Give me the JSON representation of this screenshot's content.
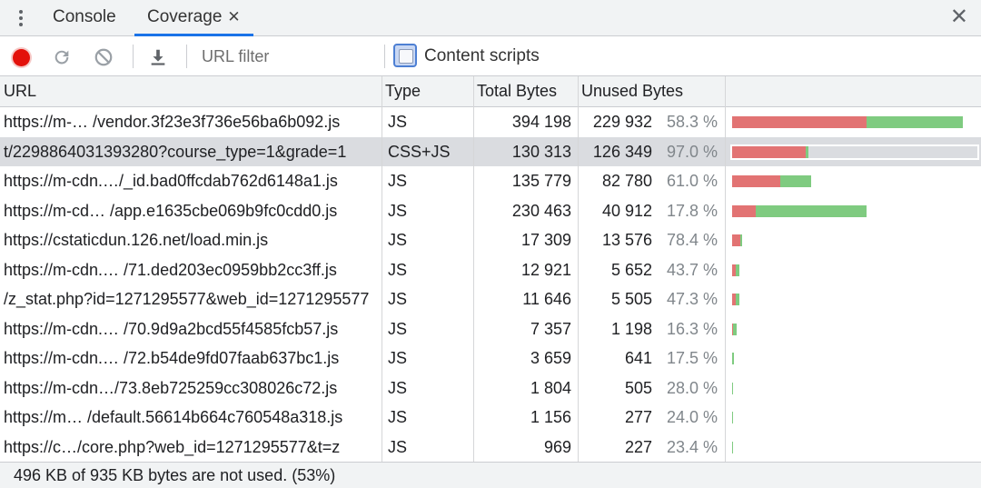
{
  "tabs": {
    "console": "Console",
    "coverage": "Coverage",
    "coverage_close": "✕"
  },
  "panel_close": "✕",
  "toolbar": {
    "url_filter_placeholder": "URL filter",
    "content_scripts_label": "Content scripts",
    "content_scripts_checked": false
  },
  "columns": {
    "url": "URL",
    "type": "Type",
    "total": "Total Bytes",
    "unused": "Unused Bytes"
  },
  "colors": {
    "unused": "#e27373",
    "used": "#7fcb80",
    "record": "#e3110b",
    "tab_accent": "#1a73e8"
  },
  "rows": [
    {
      "url": "https://m-… /vendor.3f23e3f736e56ba6b092.js",
      "type": "JS",
      "total": "394 198",
      "unused": "229 932",
      "pct": "58.3 %",
      "total_n": 394198,
      "unused_n": 229932
    },
    {
      "url": "t/2298864031393280?course_type=1&grade=1",
      "type": "CSS+JS",
      "total": "130 313",
      "unused": "126 349",
      "pct": "97.0 %",
      "total_n": 130313,
      "unused_n": 126349,
      "selected": true
    },
    {
      "url": "https://m-cdn.…/_id.bad0ffcdab762d6148a1.js",
      "type": "JS",
      "total": "135 779",
      "unused": "82 780",
      "pct": "61.0 %",
      "total_n": 135779,
      "unused_n": 82780
    },
    {
      "url": "https://m-cd… /app.e1635cbe069b9fc0cdd0.js",
      "type": "JS",
      "total": "230 463",
      "unused": "40 912",
      "pct": "17.8 %",
      "total_n": 230463,
      "unused_n": 40912
    },
    {
      "url": "https://cstaticdun.126.net/load.min.js",
      "type": "JS",
      "total": "17 309",
      "unused": "13 576",
      "pct": "78.4 %",
      "total_n": 17309,
      "unused_n": 13576
    },
    {
      "url": "https://m-cdn.… /71.ded203ec0959bb2cc3ff.js",
      "type": "JS",
      "total": "12 921",
      "unused": "5 652",
      "pct": "43.7 %",
      "total_n": 12921,
      "unused_n": 5652
    },
    {
      "url": "/z_stat.php?id=1271295577&web_id=1271295577",
      "type": "JS",
      "total": "11 646",
      "unused": "5 505",
      "pct": "47.3 %",
      "total_n": 11646,
      "unused_n": 5505
    },
    {
      "url": "https://m-cdn.… /70.9d9a2bcd55f4585fcb57.js",
      "type": "JS",
      "total": "7 357",
      "unused": "1 198",
      "pct": "16.3 %",
      "total_n": 7357,
      "unused_n": 1198
    },
    {
      "url": "https://m-cdn.… /72.b54de9fd07faab637bc1.js",
      "type": "JS",
      "total": "3 659",
      "unused": "641",
      "pct": "17.5 %",
      "total_n": 3659,
      "unused_n": 641
    },
    {
      "url": "https://m-cdn…/73.8eb725259cc308026c72.js",
      "type": "JS",
      "total": "1 804",
      "unused": "505",
      "pct": "28.0 %",
      "total_n": 1804,
      "unused_n": 505
    },
    {
      "url": "https://m… /default.56614b664c760548a318.js",
      "type": "JS",
      "total": "1 156",
      "unused": "277",
      "pct": "24.0 %",
      "total_n": 1156,
      "unused_n": 277
    },
    {
      "url": "https://c…/core.php?web_id=1271295577&t=z",
      "type": "JS",
      "total": "969",
      "unused": "227",
      "pct": "23.4 %",
      "total_n": 969,
      "unused_n": 227
    }
  ],
  "status": "496 KB of 935 KB bytes are not used. (53%)"
}
